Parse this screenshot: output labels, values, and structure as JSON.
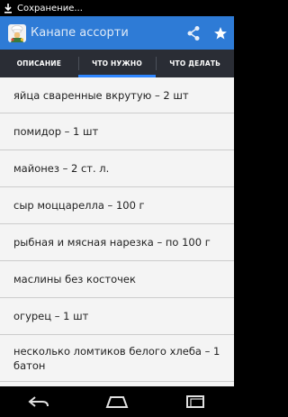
{
  "status_bar": {
    "notification_text": "Сохранение..."
  },
  "action_bar": {
    "title": "Канапе ассорти",
    "app_icon": "chef-icon",
    "actions": [
      "share-icon",
      "star-icon"
    ]
  },
  "tabs": [
    {
      "label": "ОПИСАНИЕ",
      "active": false
    },
    {
      "label": "ЧТО НУЖНО",
      "active": true
    },
    {
      "label": "ЧТО ДЕЛАТЬ",
      "active": false
    }
  ],
  "ingredients": [
    "яйца сваренные вкрутую – 2 шт",
    "помидор – 1 шт",
    "майонез – 2 ст. л.",
    "сыр моццарелла – 100 г",
    "рыбная и мясная нарезка – по 100 г",
    "маслины без косточек",
    "огурец – 1 шт",
    "несколько ломтиков белого хлеба – 1 батон"
  ],
  "nav_bar": {
    "buttons": [
      "back-icon",
      "home-icon",
      "recents-icon"
    ]
  },
  "colors": {
    "action_bar": "#2e7bd6",
    "tab_bar": "#2a2d35",
    "tab_indicator": "#2f86ff",
    "list_background": "#f4f4f4"
  }
}
